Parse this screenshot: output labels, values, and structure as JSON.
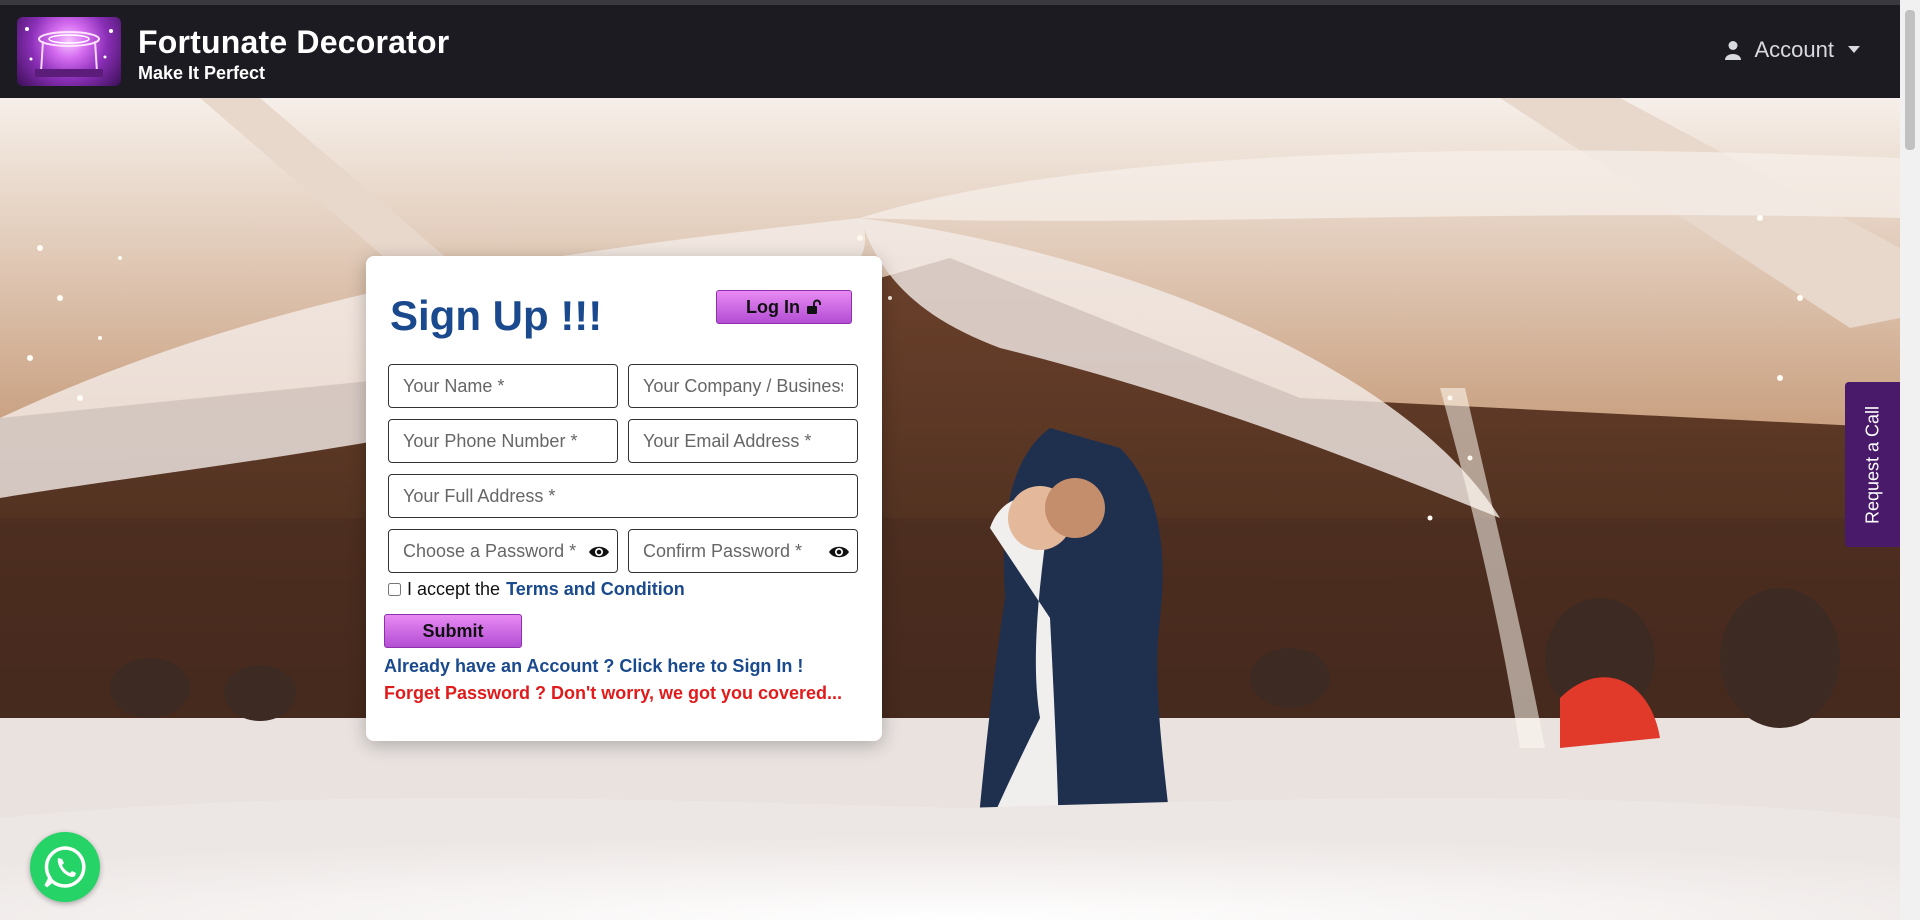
{
  "brand": {
    "title": "Fortunate Decorator",
    "tagline": "Make It Perfect",
    "logo_icon": "decor-stage-logo"
  },
  "nav": {
    "account_label": "Account",
    "account_icon": "user-icon",
    "caret_icon": "caret-down-icon"
  },
  "signup": {
    "title": "Sign Up !!!",
    "login_button": "Log In",
    "login_icon": "unlock-icon",
    "fields": {
      "name_placeholder": "Your Name *",
      "company_placeholder": "Your Company / Business Name *",
      "phone_placeholder": "Your Phone Number *",
      "email_placeholder": "Your Email Address *",
      "address_placeholder": "Your Full Address *",
      "password_placeholder": "Choose a Password *",
      "confirm_placeholder": "Confirm Password *"
    },
    "terms_prefix": "I accept the",
    "terms_link": "Terms and Condition",
    "submit": "Submit",
    "signin_link": "Already have an Account ? Click here to Sign In !",
    "forgot_link": "Forget Password ? Don't worry, we got you covered..."
  },
  "request_call": "Request a Call",
  "colors": {
    "navbar": "#1c1b22",
    "heading_blue": "#1a4a8d",
    "button_purple": "#c45ae0",
    "forgot_red": "#e11b1b",
    "request_call_bg": "#4a1a6a",
    "whatsapp_green": "#25d366"
  }
}
